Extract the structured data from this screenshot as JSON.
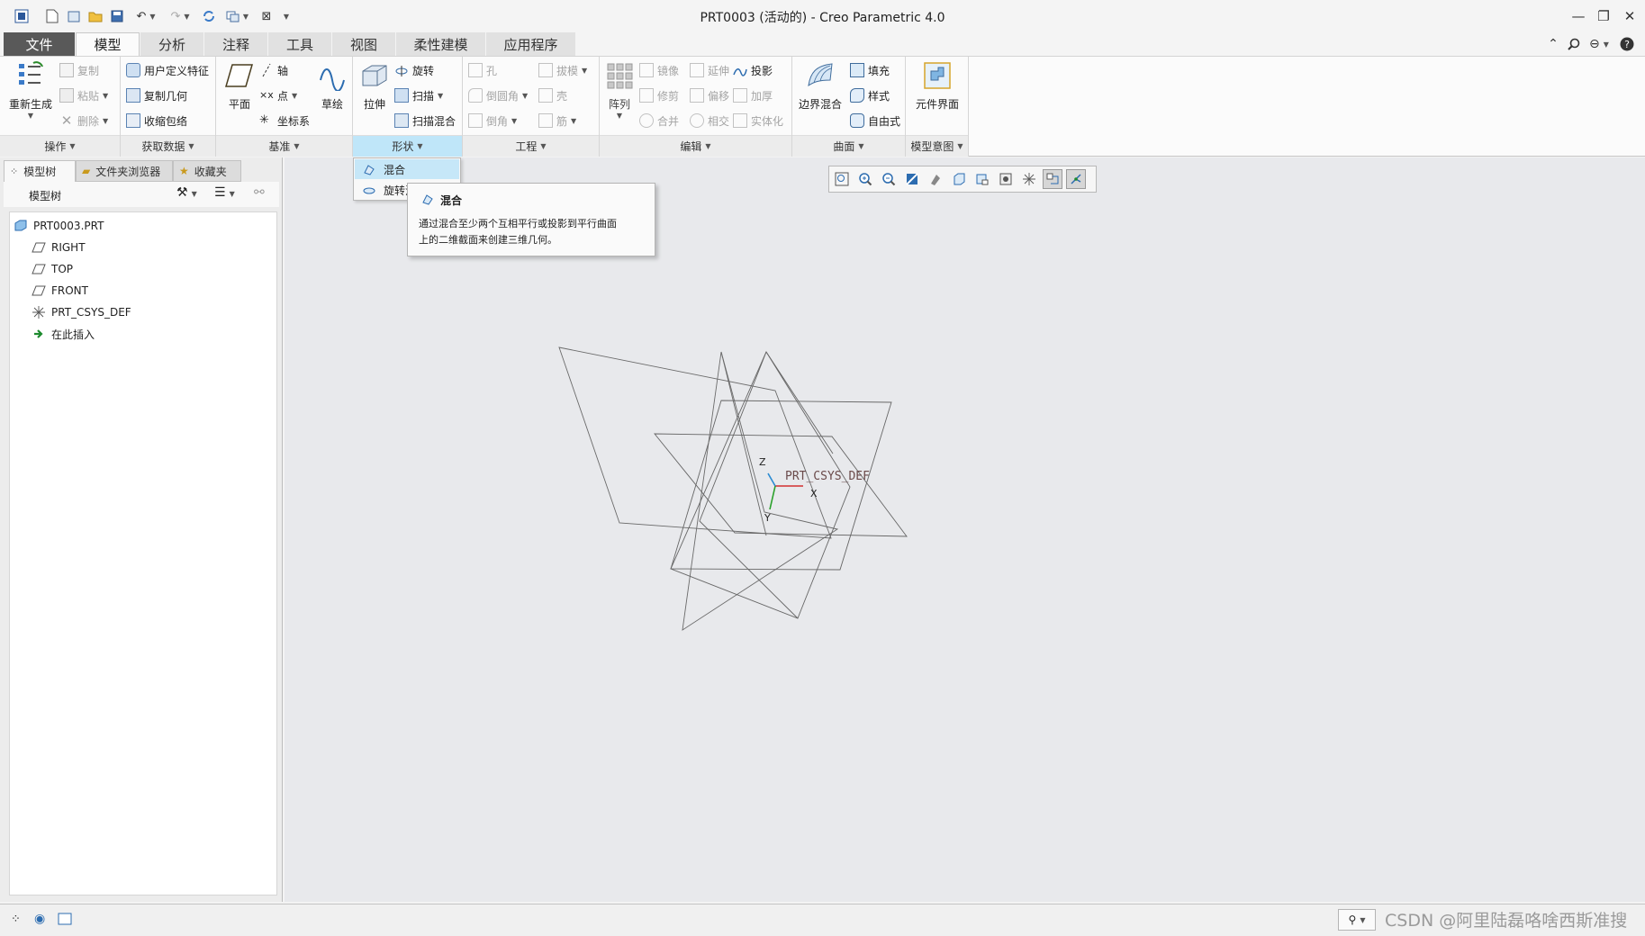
{
  "window": {
    "title": "PRT0003 (活动的) - Creo Parametric 4.0"
  },
  "tabs": [
    {
      "label": "文件"
    },
    {
      "label": "模型"
    },
    {
      "label": "分析"
    },
    {
      "label": "注释"
    },
    {
      "label": "工具"
    },
    {
      "label": "视图"
    },
    {
      "label": "柔性建模"
    },
    {
      "label": "应用程序"
    }
  ],
  "ribbon": {
    "operations": {
      "title": "操作",
      "regen": "重新生成",
      "copy": "复制",
      "paste": "粘贴",
      "delete": "删除"
    },
    "get_data": {
      "title": "获取数据",
      "udf": "用户定义特征",
      "copy_geom": "复制几何",
      "shrinkwrap": "收缩包络"
    },
    "datum": {
      "title": "基准",
      "plane": "平面",
      "axis": "轴",
      "point": "点",
      "csys": "坐标系",
      "sketch": "草绘"
    },
    "shapes": {
      "title": "形状",
      "extrude": "拉伸",
      "revolve": "旋转",
      "sweep": "扫描",
      "swept_blend": "扫描混合"
    },
    "engineering": {
      "title": "工程",
      "hole": "孔",
      "draft": "拔模",
      "round": "倒圆角",
      "shell": "壳",
      "chamfer": "倒角",
      "rib": "筋"
    },
    "editing": {
      "title": "编辑",
      "pattern": "阵列",
      "mirror": "镜像",
      "extend": "延伸",
      "project": "投影",
      "trim": "修剪",
      "offset": "偏移",
      "thicken": "加厚",
      "merge": "合并",
      "intersect": "相交",
      "solidify": "实体化"
    },
    "surfaces": {
      "title": "曲面",
      "boundary_blend": "边界混合",
      "fill": "填充",
      "style": "样式",
      "freestyle": "自由式"
    },
    "model_intent": {
      "title": "模型意图",
      "component_interface": "元件界面"
    }
  },
  "shape_menu": {
    "items": [
      {
        "label": "混合"
      },
      {
        "label": "旋转混合"
      }
    ]
  },
  "tooltip": {
    "title": "混合",
    "line1": "通过混合至少两个互相平行或投影到平行曲面",
    "line2": "上的二维截面来创建三维几何。"
  },
  "left_panel": {
    "tabs": [
      {
        "label": "模型树"
      },
      {
        "label": "文件夹浏览器"
      },
      {
        "label": "收藏夹"
      }
    ],
    "header": "模型树",
    "tree": [
      {
        "label": "PRT0003.PRT"
      },
      {
        "label": "RIGHT"
      },
      {
        "label": "TOP"
      },
      {
        "label": "FRONT"
      },
      {
        "label": "PRT_CSYS_DEF"
      },
      {
        "label": "在此插入"
      }
    ]
  },
  "viewport": {
    "csys_label": "PRT_CSYS_DEF",
    "axis_x": "X",
    "axis_y": "Y",
    "axis_z": "Z"
  },
  "status": {
    "watermark": "CSDN @阿里陆磊咯啥西斯准搜"
  },
  "colors": {
    "accent": "#bfe6f9",
    "file_tab": "#595959",
    "viewport_bg": "#e8e9ec"
  }
}
